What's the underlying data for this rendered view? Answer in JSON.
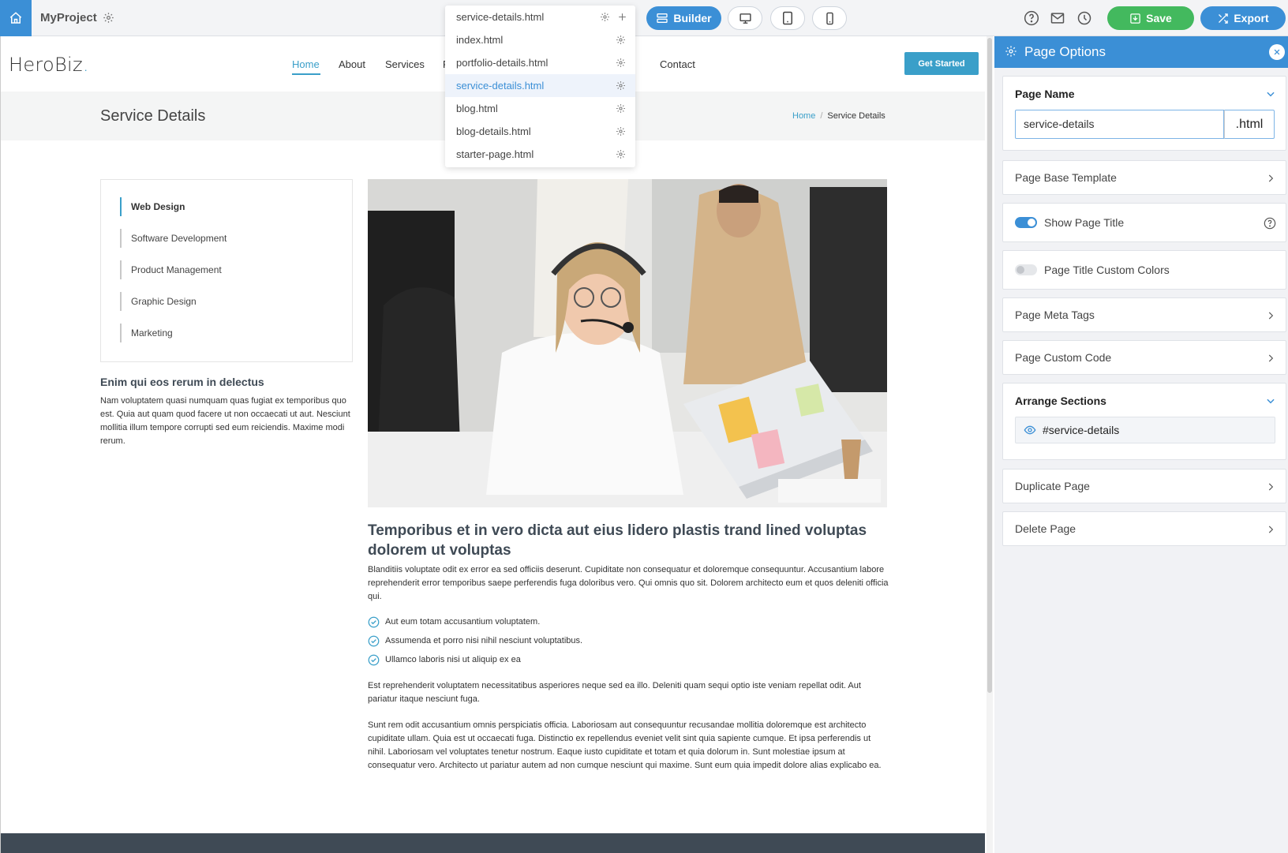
{
  "topbar": {
    "project_name": "MyProject",
    "builder_label": "Builder",
    "save_label": "Save",
    "export_label": "Export"
  },
  "page_dropdown": {
    "current": "service-details.html",
    "items": [
      {
        "label": "index.html"
      },
      {
        "label": "portfolio-details.html"
      },
      {
        "label": "service-details.html",
        "selected": true
      },
      {
        "label": "blog.html"
      },
      {
        "label": "blog-details.html"
      },
      {
        "label": "starter-page.html"
      }
    ]
  },
  "site": {
    "logo": "HeroBiz",
    "logo_dot": ".",
    "nav": {
      "home": "Home",
      "about": "About",
      "services": "Services",
      "hidden_letter": "P",
      "contact": "Contact"
    },
    "cta": "Get Started",
    "page_title": "Service Details",
    "breadcrumb": {
      "home": "Home",
      "sep": "/",
      "current": "Service Details"
    },
    "services": [
      "Web Design",
      "Software Development",
      "Product Management",
      "Graphic Design",
      "Marketing"
    ],
    "side_heading": "Enim qui eos rerum in delectus",
    "side_text": "Nam voluptatem quasi numquam quas fugiat ex temporibus quo est. Quia aut quam quod facere ut non occaecati ut aut. Nesciunt mollitia illum tempore corrupti sed eum reiciendis. Maxime modi rerum.",
    "main_heading": "Temporibus et in vero dicta aut eius lidero plastis trand lined voluptas dolorem ut voluptas",
    "main_text1": "Blanditiis voluptate odit ex error ea sed officiis deserunt. Cupiditate non consequatur et doloremque consequuntur. Accusantium labore reprehenderit error temporibus saepe perferendis fuga doloribus vero. Qui omnis quo sit. Dolorem architecto eum et quos deleniti officia qui.",
    "checks": [
      "Aut eum totam accusantium voluptatem.",
      "Assumenda et porro nisi nihil nesciunt voluptatibus.",
      "Ullamco laboris nisi ut aliquip ex ea"
    ],
    "main_text2": "Est reprehenderit voluptatem necessitatibus asperiores neque sed ea illo. Deleniti quam sequi optio iste veniam repellat odit. Aut pariatur itaque nesciunt fuga.",
    "main_text3": "Sunt rem odit accusantium omnis perspiciatis officia. Laboriosam aut consequuntur recusandae mollitia doloremque est architecto cupiditate ullam. Quia est ut occaecati fuga. Distinctio ex repellendus eveniet velit sint quia sapiente cumque. Et ipsa perferendis ut nihil. Laboriosam vel voluptates tenetur nostrum. Eaque iusto cupiditate et totam et quia dolorum in. Sunt molestiae ipsum at consequatur vero. Architecto ut pariatur autem ad non cumque nesciunt qui maxime. Sunt eum quia impedit dolore alias explicabo ea."
  },
  "panel": {
    "title": "Page Options",
    "page_name_label": "Page Name",
    "page_name_value": "service-details",
    "page_name_suffix": ".html",
    "base_template": "Page Base Template",
    "show_title": "Show Page Title",
    "show_title_on": true,
    "title_colors": "Page Title Custom Colors",
    "title_colors_on": false,
    "meta_tags": "Page Meta Tags",
    "custom_code": "Page Custom Code",
    "arrange": "Arrange Sections",
    "section_item": "#service-details",
    "duplicate": "Duplicate Page",
    "delete": "Delete Page"
  },
  "colors": {
    "accent": "#3b8fd6",
    "site_accent": "#3a9fc9",
    "save_green": "#43b95e",
    "footer": "#3f4a55"
  }
}
